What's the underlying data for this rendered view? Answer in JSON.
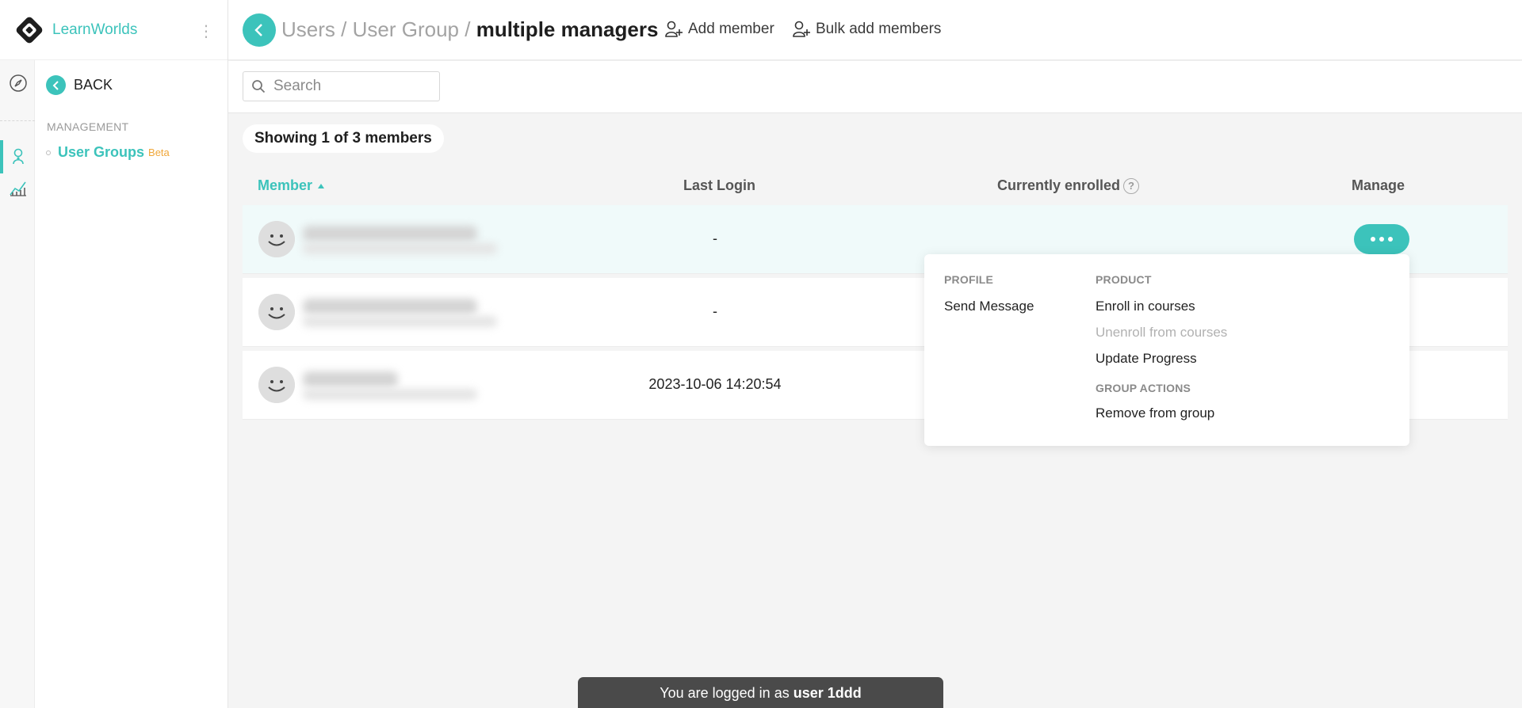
{
  "brand": {
    "name": "LearnWorlds",
    "menu_icon": "vertical-dots-icon"
  },
  "sidebar": {
    "back_label": "BACK",
    "section_label": "MANAGEMENT",
    "items": [
      {
        "label": "User Groups",
        "badge": "Beta",
        "active": true
      }
    ],
    "rail_icons": [
      "compass-icon",
      "user-groups-icon",
      "analytics-icon"
    ]
  },
  "header": {
    "breadcrumb": [
      "Users",
      "User Group"
    ],
    "separator": "/",
    "current": "multiple managers",
    "actions": [
      {
        "label": "Add member",
        "icon": "add-user-icon"
      },
      {
        "label": "Bulk add members",
        "icon": "add-users-icon"
      }
    ]
  },
  "search": {
    "placeholder": "Search",
    "value": ""
  },
  "summary": "Showing 1 of 3 members",
  "table": {
    "columns": [
      "Member",
      "Last Login",
      "Currently enrolled",
      "Manage"
    ],
    "sort": {
      "column": "Member",
      "direction": "ascending"
    },
    "rows": [
      {
        "last_login": "-",
        "highlighted": true
      },
      {
        "last_login": "-",
        "highlighted": false
      },
      {
        "last_login": "2023-10-06 14:20:54",
        "highlighted": false
      }
    ]
  },
  "manage_menu": {
    "profile_heading": "PROFILE",
    "profile_items": [
      {
        "label": "Send Message",
        "enabled": true
      }
    ],
    "product_heading": "PRODUCT",
    "product_items": [
      {
        "label": "Enroll in courses",
        "enabled": true
      },
      {
        "label": "Unenroll from courses",
        "enabled": false
      },
      {
        "label": "Update Progress",
        "enabled": true
      }
    ],
    "group_heading": "GROUP ACTIONS",
    "group_items": [
      {
        "label": "Remove from group",
        "enabled": true
      }
    ]
  },
  "footer": {
    "prefix": "You are logged in as",
    "user": "user 1ddd"
  },
  "colors": {
    "accent": "#3cc3bb",
    "beta": "#f0a73a",
    "toast": "#4a4a4a"
  }
}
